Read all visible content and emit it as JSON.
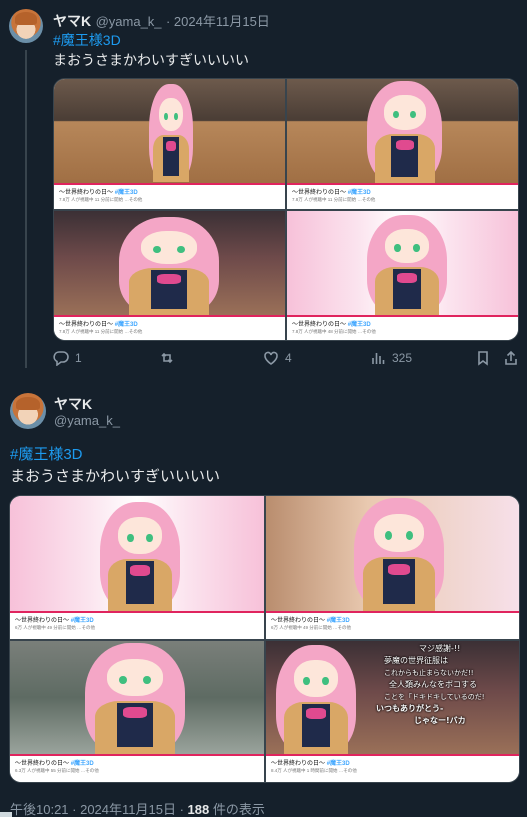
{
  "tweet1": {
    "name": "ヤマK",
    "handle": "@yama_k_",
    "date": "· 2024年11月15日",
    "hashtag": "#魔王様3D",
    "text": "まおうさまかわいすぎいいいい",
    "media": [
      {
        "title": "～世界終わりの日～",
        "tag": "#魔王3D",
        "sub": "7.8万 人が視聴中 11 分前に開始 …その他"
      },
      {
        "title": "～世界終わりの日～",
        "tag": "#魔王3D",
        "sub": "7.8万 人が視聴中 11 分前に開始 …その他"
      },
      {
        "title": "～世界終わりの日～",
        "tag": "#魔王3D",
        "sub": "7.8万 人が視聴中 11 分前に開始 …その他"
      },
      {
        "title": "～世界終わりの日～",
        "tag": "#魔王3D",
        "sub": "7.8万 人が視聴中 48 分前に開始 …その他"
      }
    ],
    "actions": {
      "reply": "1",
      "retweet": "",
      "like": "4",
      "views": "325"
    }
  },
  "tweet2": {
    "name": "ヤマK",
    "handle": "@yama_k_",
    "hashtag": "#魔王様3D",
    "text": "まおうさまかわいすぎいいいい",
    "media": [
      {
        "title": "～世界終わりの日～",
        "tag": "#魔王3D",
        "sub": "6万 人が視聴中 49 分前に開始 …その他"
      },
      {
        "title": "～世界終わりの日～",
        "tag": "#魔王3D",
        "sub": "6万 人が視聴中 49 分前に開始 …その他"
      },
      {
        "title": "～世界終わりの日～",
        "tag": "#魔王3D",
        "sub": "6.3万 人が視聴中 55 分前に開始 …その他"
      },
      {
        "title": "～世界終わりの日～",
        "tag": "#魔王3D",
        "sub": "8.4万 人が視聴中 1 時間前に開始 …その他"
      }
    ],
    "overlay_lines": [
      "マジ感謝-!!",
      "夢魔の世界征服は",
      "これからも止まらないかだ!!",
      "全人類みんなをボコする",
      "ことを「ドキドキしているのだ!",
      "いつもありがとう-",
      "じゃなー!バカ"
    ]
  },
  "footer": {
    "time": "午後10:21 · 2024年11月15日 ·",
    "count": "188",
    "count_label": "件の表示"
  },
  "colors": {
    "background": "#15202b",
    "accent": "#1d9bf0",
    "text": "#e7e9ea",
    "muted": "#8b98a5"
  },
  "icons": {
    "reply": "reply-icon",
    "retweet": "retweet-icon",
    "like": "heart-icon",
    "views": "bar-chart-icon",
    "bookmark": "bookmark-icon",
    "share": "share-icon"
  }
}
